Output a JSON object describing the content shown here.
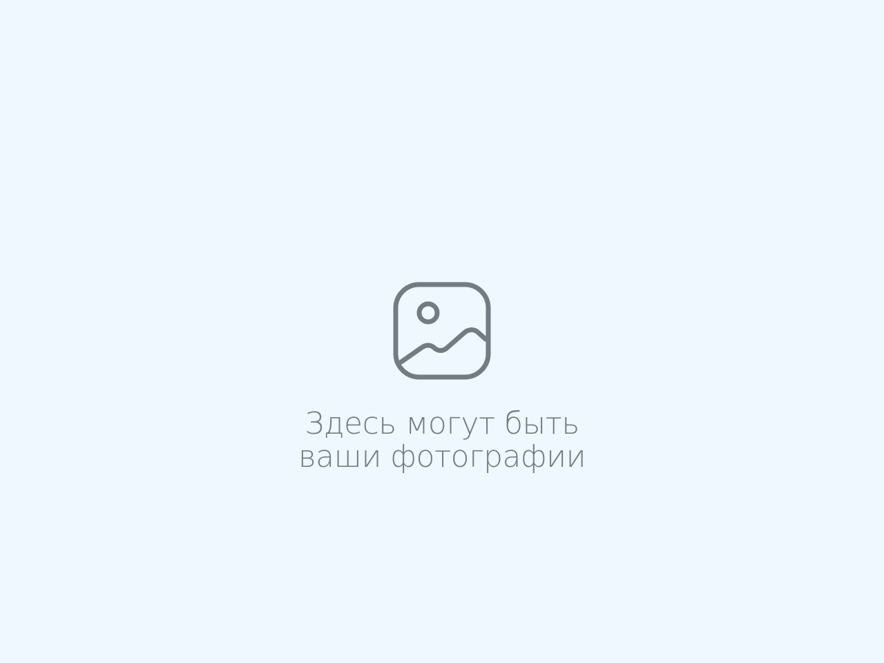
{
  "placeholder": {
    "icon": "image-placeholder-icon",
    "caption_line_1": "Здесь могут быть",
    "caption_line_2": "ваши фотографии"
  },
  "colors": {
    "background": "#eef8fe",
    "icon_stroke": "#737b84",
    "caption_text": "#737b84"
  }
}
